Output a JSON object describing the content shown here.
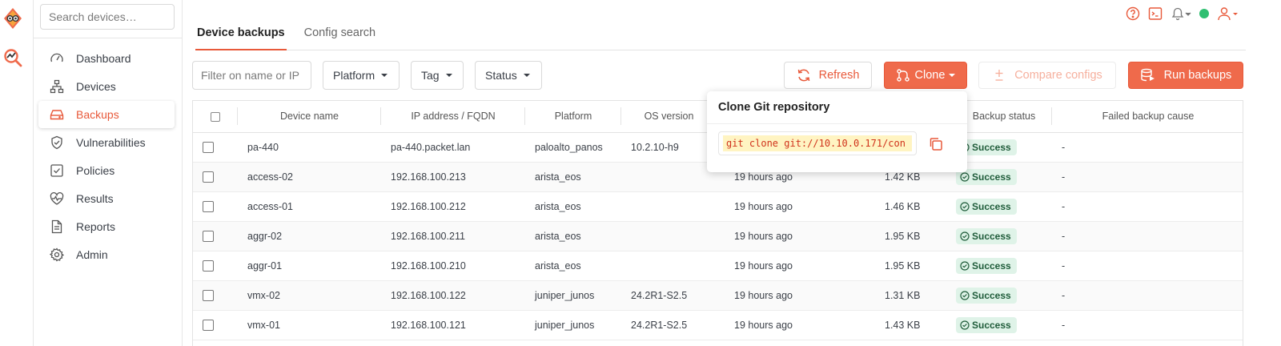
{
  "sidebar": {
    "search_placeholder": "Search devices…",
    "items": [
      {
        "label": "Dashboard",
        "icon": "gauge-icon"
      },
      {
        "label": "Devices",
        "icon": "network-icon"
      },
      {
        "label": "Backups",
        "icon": "hdd-icon",
        "active": true
      },
      {
        "label": "Vulnerabilities",
        "icon": "shield-icon"
      },
      {
        "label": "Policies",
        "icon": "check-square-icon"
      },
      {
        "label": "Results",
        "icon": "heart-pulse-icon"
      },
      {
        "label": "Reports",
        "icon": "file-icon"
      },
      {
        "label": "Admin",
        "icon": "gear-icon"
      }
    ]
  },
  "tabs": [
    {
      "label": "Device backups",
      "active": true
    },
    {
      "label": "Config search",
      "active": false
    }
  ],
  "toolbar": {
    "filter_placeholder": "Filter on name or IP",
    "platform_label": "Platform",
    "tag_label": "Tag",
    "status_label": "Status",
    "refresh_label": "Refresh",
    "clone_label": "Clone",
    "compare_label": "Compare configs",
    "run_label": "Run backups"
  },
  "popover": {
    "title": "Clone Git repository",
    "command": "git clone git://10.10.0.171/con"
  },
  "table": {
    "headers": [
      "Device name",
      "IP address / FQDN",
      "Platform",
      "OS version",
      "",
      "",
      "Backup status",
      "Failed backup cause"
    ],
    "rows": [
      {
        "name": "pa-440",
        "ip": "pa-440.packet.lan",
        "platform": "paloalto_panos",
        "os": "10.2.10-h9",
        "time": "",
        "size": "",
        "status": "Success",
        "cause": "-"
      },
      {
        "name": "access-02",
        "ip": "192.168.100.213",
        "platform": "arista_eos",
        "os": "",
        "time": "19 hours ago",
        "size": "1.42 KB",
        "status": "Success",
        "cause": "-"
      },
      {
        "name": "access-01",
        "ip": "192.168.100.212",
        "platform": "arista_eos",
        "os": "",
        "time": "19 hours ago",
        "size": "1.46 KB",
        "status": "Success",
        "cause": "-"
      },
      {
        "name": "aggr-02",
        "ip": "192.168.100.211",
        "platform": "arista_eos",
        "os": "",
        "time": "19 hours ago",
        "size": "1.95 KB",
        "status": "Success",
        "cause": "-"
      },
      {
        "name": "aggr-01",
        "ip": "192.168.100.210",
        "platform": "arista_eos",
        "os": "",
        "time": "19 hours ago",
        "size": "1.95 KB",
        "status": "Success",
        "cause": "-"
      },
      {
        "name": "vmx-02",
        "ip": "192.168.100.122",
        "platform": "juniper_junos",
        "os": "24.2R1-S2.5",
        "time": "19 hours ago",
        "size": "1.31 KB",
        "status": "Success",
        "cause": "-"
      },
      {
        "name": "vmx-01",
        "ip": "192.168.100.121",
        "platform": "juniper_junos",
        "os": "24.2R1-S2.5",
        "time": "19 hours ago",
        "size": "1.43 KB",
        "status": "Success",
        "cause": "-"
      }
    ]
  },
  "colors": {
    "accent": "#e8593a",
    "status_online": "#2fbf71",
    "success_bg": "#dff3e8"
  }
}
